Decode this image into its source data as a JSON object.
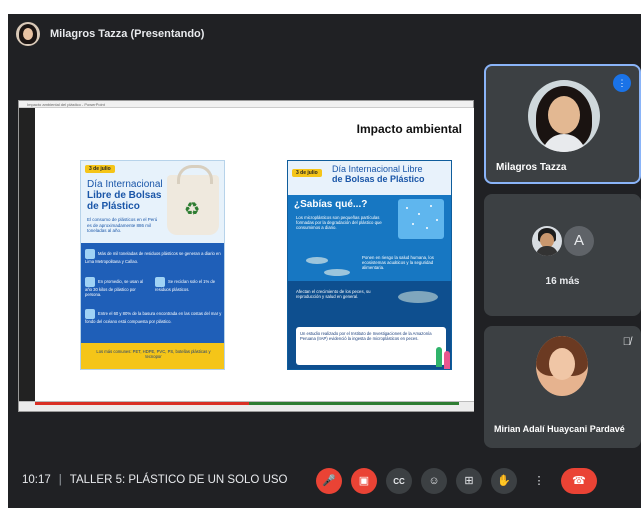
{
  "presenter": {
    "name": "Milagros Tazza (Presentando)"
  },
  "slide": {
    "window_title": "Impacto ambiental del plástico - PowerPoint",
    "heading": "Impacto ambiental",
    "poster_left": {
      "date": "3 de julio",
      "title_line1": "Día Internacional",
      "title_line2": "Libre de Bolsas de Plástico",
      "intro": "El consumo de plásticos en el Perú es de aproximadamente 886 mil toneladas al año.",
      "row1": "Más de mil toneladas de residuos plásticos se generan a diario en Lima Metropolitana y Callao.",
      "row2a": "En promedio, se usan al año 30 kilos de plástico por persona.",
      "row2b": "Se reciclan solo el 1% de residuos plásticos.",
      "row3": "Entre el 60 y 80% de la basura encontrada en las costas del mar y fondo del océano está compuesta por plástico.",
      "footer": "Los más comunes: PET, HDPE, PVC, PS, botellas plásticas y tecnopor"
    },
    "poster_right": {
      "date": "3 de julio",
      "title_line1": "Día Internacional Libre",
      "title_line2": "de Bolsas de Plástico",
      "question": "¿Sabías qué...?",
      "fact1": "Los microplásticos son pequeñas partículas formadas por la degradación del plástico que consumimos a diario.",
      "fact2": "Ponen en riesgo la salud humana, los ecosistemas acuáticos y la seguridad alimentaria.",
      "fact3": "Afectan el crecimiento de los peces, su reproducción y salud en general.",
      "study": "Un estudio realizado por el Instituto de Investigaciones de la Amazonía Peruana (IIAP) evidenció la ingesta de microplásticos en peces."
    }
  },
  "participants": {
    "main": {
      "name": "Milagros Tazza"
    },
    "group": {
      "letter": "A",
      "more_label": "16 más"
    },
    "third": {
      "name": "Mirian Adalí Huaycani Pardavé"
    }
  },
  "meeting": {
    "time": "10:17",
    "separator": "|",
    "title": "TALLER 5: PLÁSTICO DE UN SOLO USO"
  },
  "controls": {
    "mic": "mic-off-icon",
    "camera": "camera-off-icon",
    "captions_label": "CC",
    "reactions": "emoji-icon",
    "present": "present-icon",
    "hand": "raise-hand-icon",
    "more": "more-vert-icon",
    "leave": "phone-hangup-icon"
  },
  "colors": {
    "accent": "#8ab4f8",
    "danger": "#ea4335",
    "background": "#202124",
    "tile": "#3c4043"
  }
}
